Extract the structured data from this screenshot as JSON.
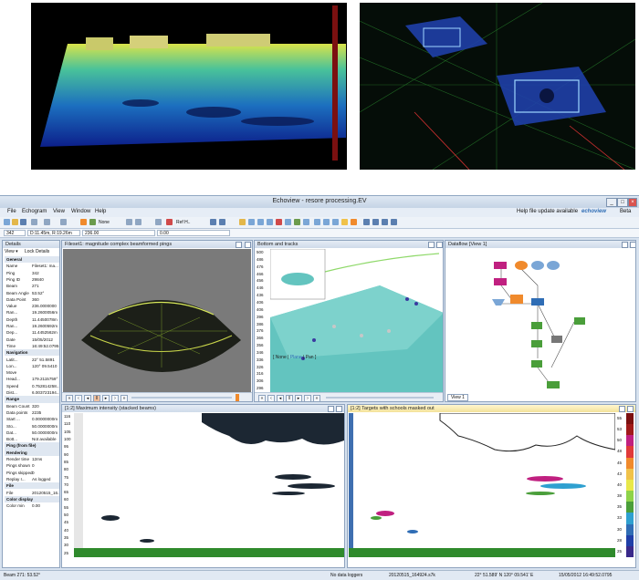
{
  "window": {
    "title": "Echoview - resore processing.EV",
    "help_text": "Help file update available",
    "brand": "echoview",
    "brand_suffix": "Beta"
  },
  "menu": [
    "File",
    "Echogram",
    "View",
    "Window",
    "Help"
  ],
  "toolbar": {
    "none_label": "None",
    "ref_label": "Ref H.."
  },
  "status_row": {
    "ping": "342",
    "position": "D:11.45m, R:19.26m",
    "angle": "236.00",
    "value": "0.00"
  },
  "panels": {
    "details": {
      "title": "Details",
      "view_label": "View ▾",
      "lock_label": "Lock Details"
    },
    "fileset": {
      "title": "Fileset1: magnitude complex beamformed pings"
    },
    "bottom": {
      "title": "Bottom and tracks",
      "legend": [
        "None",
        "Plane",
        "Pan"
      ]
    },
    "dataflow": {
      "title": "Dataflow [View 1]",
      "tab": "View 1"
    },
    "stacked": {
      "title": "[1:2] Maximum intensity (stacked beams)"
    },
    "targets": {
      "title": "[1:2] Targets with schools masked out"
    }
  },
  "details_rows": [
    {
      "k": "General",
      "v": "",
      "sec": true
    },
    {
      "k": "Name",
      "v": "Fileset1: ma..."
    },
    {
      "k": "Ping",
      "v": "342"
    },
    {
      "k": "Ping ID",
      "v": "29840"
    },
    {
      "k": "Beam",
      "v": "271"
    },
    {
      "k": "Beam Angle",
      "v": "53.52°"
    },
    {
      "k": "Data Point",
      "v": "360"
    },
    {
      "k": "Value",
      "v": "236.0000000"
    },
    {
      "k": "Ran...",
      "v": "19.2600056m"
    },
    {
      "k": "Depth",
      "v": "11.4450078m"
    },
    {
      "k": "Ran...",
      "v": "19.2600592m"
    },
    {
      "k": "Dep...",
      "v": "11.4452562m"
    },
    {
      "k": "Date",
      "v": "15/05/2012"
    },
    {
      "k": "Time",
      "v": "16:49:52.0795"
    },
    {
      "k": "Navigation",
      "v": "",
      "sec": true
    },
    {
      "k": "Latit...",
      "v": "22° 51.5891"
    },
    {
      "k": "Lon...",
      "v": "120° 09.5410"
    },
    {
      "k": "Move",
      "v": ""
    },
    {
      "k": "Head...",
      "v": "179.2115759°"
    },
    {
      "k": "Speed",
      "v": "0.752814258..."
    },
    {
      "k": "Dist...",
      "v": "6.003723194..."
    },
    {
      "k": "Range",
      "v": "",
      "sec": true
    },
    {
      "k": "Beam Count",
      "v": "320"
    },
    {
      "k": "Data points",
      "v": "2235"
    },
    {
      "k": "Start ...",
      "v": "0.00000000m"
    },
    {
      "k": "Sto...",
      "v": "50.0000000m"
    },
    {
      "k": "Dat...",
      "v": "50.0000000m"
    },
    {
      "k": "Bott...",
      "v": "Not available"
    },
    {
      "k": "Ping (from file)",
      "v": "",
      "sec": true
    },
    {
      "k": "Rendering",
      "v": "",
      "sec": true
    },
    {
      "k": "Render time",
      "v": "12ms"
    },
    {
      "k": "Pings shown",
      "v": "0"
    },
    {
      "k": "Pings skipped",
      "v": "0"
    },
    {
      "k": "Replay r...",
      "v": "As logged"
    },
    {
      "k": "File",
      "v": "",
      "sec": true
    },
    {
      "k": "File",
      "v": "20120515_16..."
    },
    {
      "k": "Color display",
      "v": "",
      "sec": true
    },
    {
      "k": "Color min",
      "v": "0.00"
    }
  ],
  "depth_scale": [
    "500",
    "486",
    "476",
    "466",
    "456",
    "446",
    "436",
    "406",
    "406",
    "396",
    "386",
    "376",
    "366",
    "356",
    "346",
    "336",
    "326",
    "316",
    "306",
    "296"
  ],
  "left_scale": [
    "116",
    "110",
    "105",
    "100",
    "95",
    "90",
    "85",
    "80",
    "75",
    "70",
    "65",
    "60",
    "55",
    "50",
    "45",
    "40",
    "35",
    "30",
    "25"
  ],
  "right_scale": [
    "55",
    "53",
    "50",
    "48",
    "45",
    "43",
    "40",
    "38",
    "35",
    "33",
    "30",
    "28",
    "25"
  ],
  "status_bar": {
    "left": "Beam 271: 53.52°",
    "logger": "No data loggers",
    "file": "20120515_164924.s7k",
    "coords": "22° 51.589' N 120° 09.541' E",
    "datetime": "15/05/2012 16:49:52.0795"
  },
  "colors": {
    "accent": "#2f6db5",
    "ttlbar": "#cfdbea",
    "highlight": "#f3e29a"
  }
}
